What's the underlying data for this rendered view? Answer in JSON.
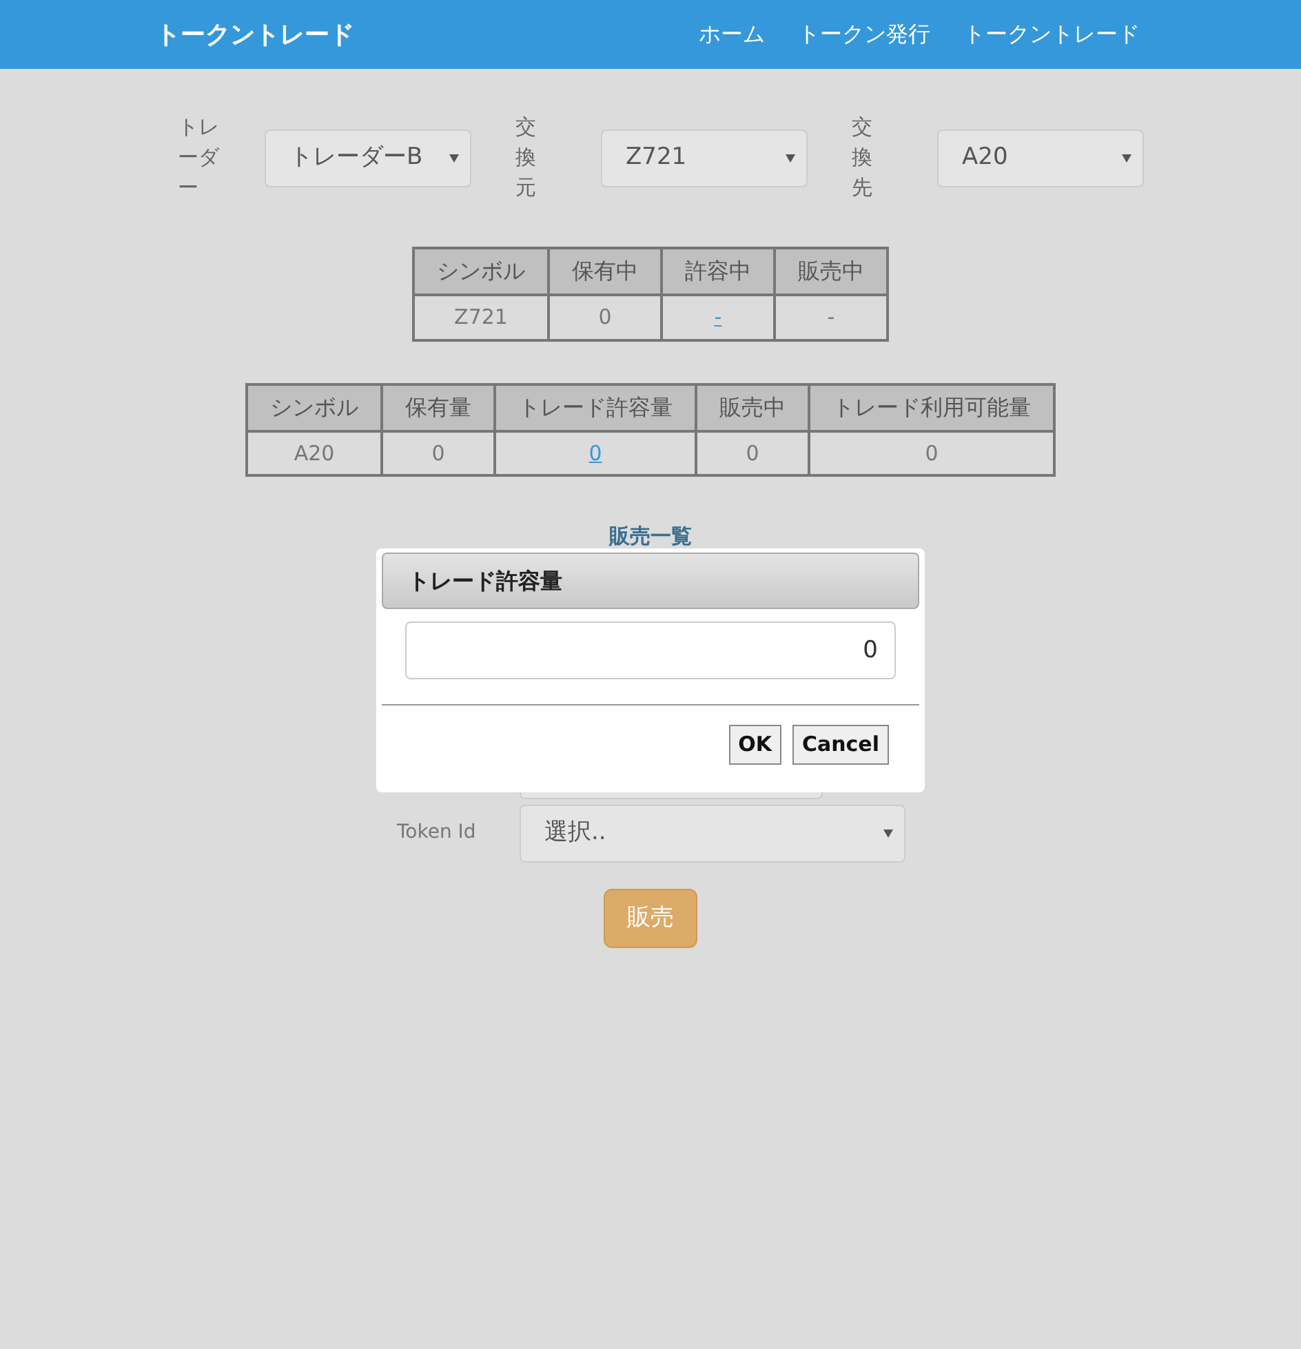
{
  "navbar": {
    "brand": "トークントレード",
    "links": [
      {
        "label": "ホーム"
      },
      {
        "label": "トークン発行"
      },
      {
        "label": "トークントレード"
      }
    ]
  },
  "selectors": [
    {
      "label": "トレーダー",
      "value": "トレーダーB",
      "kind": "wide"
    },
    {
      "label": "交換元",
      "value": "Z721",
      "kind": "vertical"
    },
    {
      "label": "交換先",
      "value": "A20",
      "kind": "vertical"
    }
  ],
  "source_table": {
    "columns": [
      "シンボル",
      "保有中",
      "許容中",
      "販売中"
    ],
    "rows": [
      [
        {
          "text": "Z721",
          "link": false
        },
        {
          "text": "0",
          "link": false
        },
        {
          "text": "-",
          "link": true
        },
        {
          "text": "-",
          "link": false
        }
      ]
    ]
  },
  "target_table": {
    "columns": [
      "シンボル",
      "保有量",
      "トレード許容量",
      "販売中",
      "トレード利用可能量"
    ],
    "rows": [
      [
        {
          "text": "A20",
          "link": false
        },
        {
          "text": "0",
          "link": false
        },
        {
          "text": "0",
          "link": true
        },
        {
          "text": "0",
          "link": false
        },
        {
          "text": "0",
          "link": false
        }
      ]
    ]
  },
  "sales_list": {
    "title": "販売一覧"
  },
  "sell_form": {
    "token_id_label": "Token Id",
    "token_id_value": "選択..",
    "sell_button": "販売"
  },
  "dialog": {
    "title": "トレード許容量",
    "value": "0",
    "buttons": [
      "OK",
      "Cancel"
    ]
  }
}
